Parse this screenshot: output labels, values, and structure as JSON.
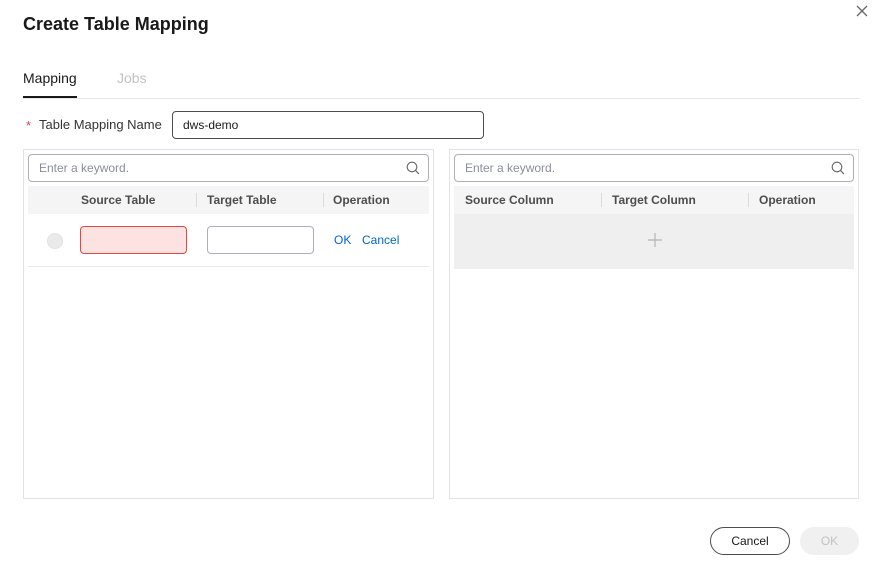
{
  "dialog": {
    "title": "Create Table Mapping",
    "close_icon": "close-icon"
  },
  "tabs": [
    {
      "label": "Mapping",
      "active": true
    },
    {
      "label": "Jobs",
      "active": false
    }
  ],
  "form": {
    "required_mark": "*",
    "name_label": "Table Mapping Name",
    "name_value": "dws-demo"
  },
  "left_panel": {
    "search_placeholder": "Enter a keyword.",
    "columns": [
      "Source Table",
      "Target Table",
      "Operation"
    ],
    "edit_row": {
      "source_value": "",
      "target_value": "",
      "ok_label": "OK",
      "cancel_label": "Cancel"
    }
  },
  "right_panel": {
    "search_placeholder": "Enter a keyword.",
    "columns": [
      "Source Column",
      "Target Column",
      "Operation"
    ],
    "add_icon": "plus-icon"
  },
  "footer": {
    "cancel_label": "Cancel",
    "ok_label": "OK"
  },
  "colors": {
    "link": "#0066cc",
    "error_border": "#e54545",
    "error_fill": "#fde2e2",
    "disabled_text": "#c2c2c2"
  }
}
